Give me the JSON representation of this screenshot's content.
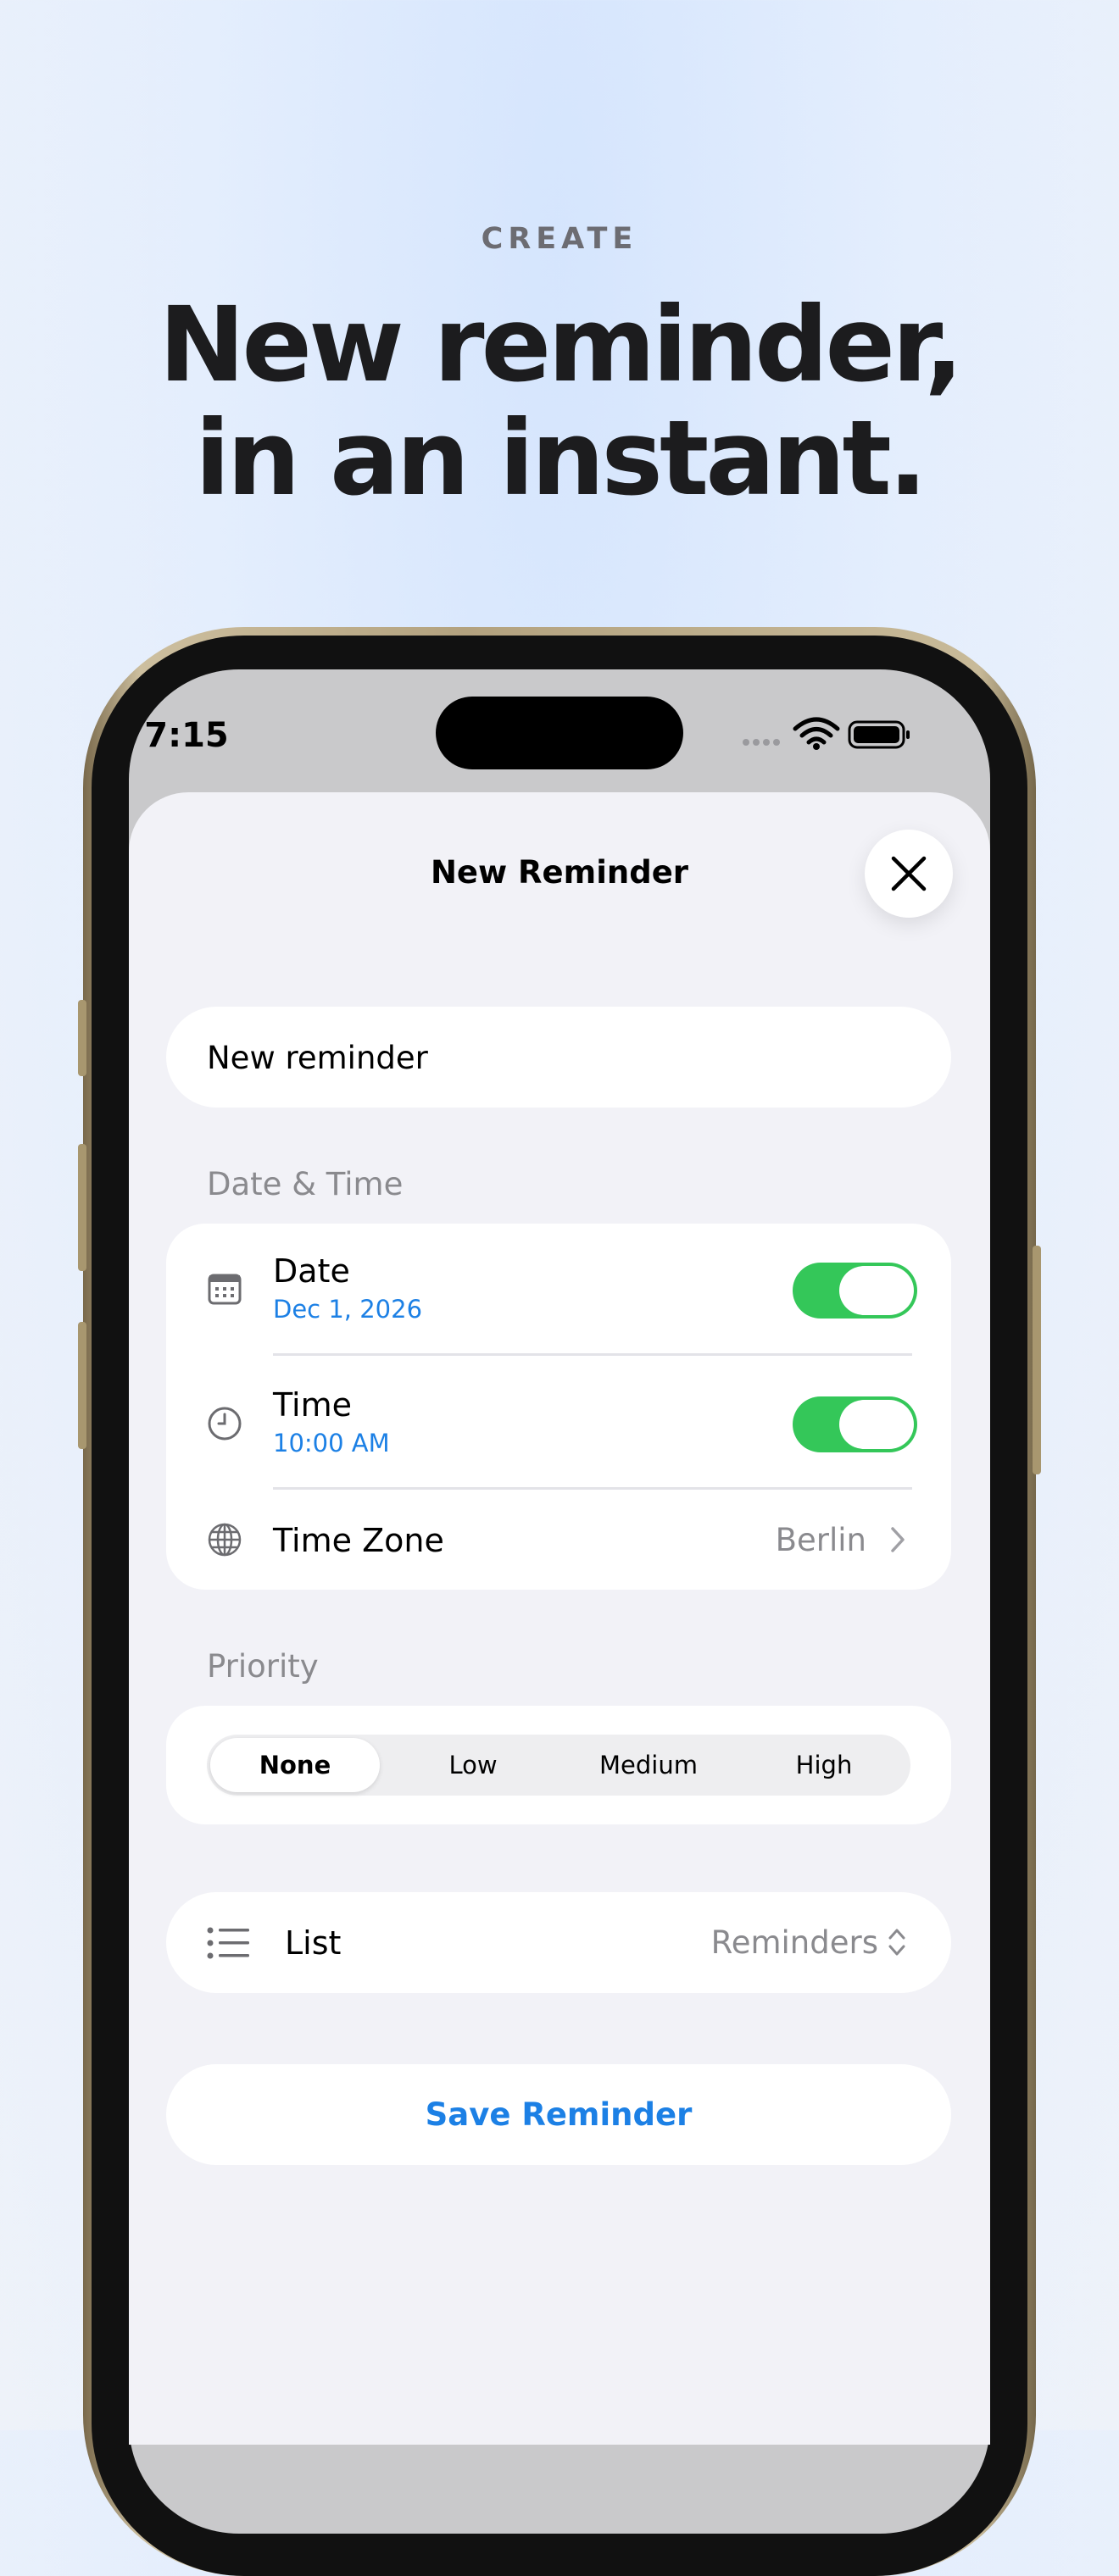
{
  "promo": {
    "eyebrow": "CREATE",
    "headline_line1": "New reminder,",
    "headline_line2": "in an instant."
  },
  "status_bar": {
    "time": "7:15"
  },
  "sheet": {
    "title": "New Reminder",
    "close_icon": "xmark-icon"
  },
  "title_field": {
    "placeholder": "New reminder",
    "value": ""
  },
  "date_time": {
    "header": "Date & Time",
    "date": {
      "label": "Date",
      "value": "Dec 1, 2026",
      "enabled": true,
      "icon": "calendar-icon"
    },
    "time": {
      "label": "Time",
      "value": "10:00 AM",
      "enabled": true,
      "icon": "clock-icon"
    },
    "time_zone": {
      "label": "Time Zone",
      "value": "Berlin",
      "icon": "globe-icon"
    }
  },
  "priority": {
    "header": "Priority",
    "options": [
      "None",
      "Low",
      "Medium",
      "High"
    ],
    "selected": "None"
  },
  "list_row": {
    "label": "List",
    "value": "Reminders",
    "icon": "list-bullet-icon"
  },
  "save_button": {
    "label": "Save Reminder"
  },
  "colors": {
    "accent": "#1c80e5",
    "toggle_on": "#34c759",
    "secondary_text": "#8a8a8e",
    "background": "#f2f2f7"
  }
}
